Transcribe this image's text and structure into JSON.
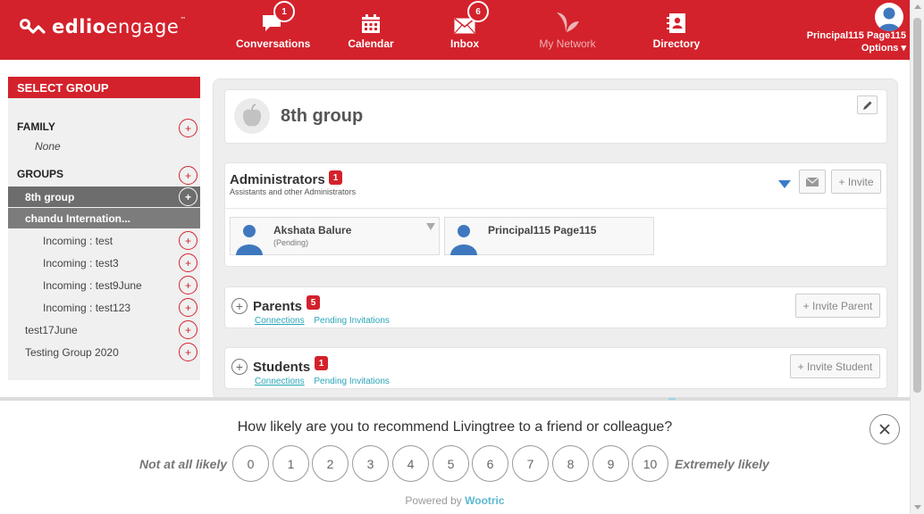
{
  "app": {
    "logo_bold": "edlio",
    "logo_light": "engage",
    "logo_tm": "™"
  },
  "nav": [
    {
      "label": "Conversations",
      "icon": "chat-bubble-icon",
      "badge": "1"
    },
    {
      "label": "Calendar",
      "icon": "calendar-icon",
      "badge": ""
    },
    {
      "label": "Inbox",
      "icon": "envelope-icon",
      "badge": "6"
    },
    {
      "label": "My Network",
      "icon": "leaf-icon",
      "badge": ""
    },
    {
      "label": "Directory",
      "icon": "directory-icon",
      "badge": ""
    }
  ],
  "user": {
    "name": "Principal115 Page115",
    "options_label": "Options ▾"
  },
  "sidebar": {
    "header": "SELECT GROUP",
    "family_label": "FAMILY",
    "family_none": "None",
    "groups_label": "GROUPS",
    "plus": "+",
    "items": [
      {
        "label": "8th group"
      },
      {
        "label": "chandu Internation..."
      },
      {
        "label": "Incoming : test"
      },
      {
        "label": "Incoming : test3"
      },
      {
        "label": "Incoming : test9June"
      },
      {
        "label": "Incoming : test123"
      },
      {
        "label": "test17June"
      },
      {
        "label": "Testing Group 2020"
      }
    ]
  },
  "group": {
    "title": "8th group"
  },
  "administrators": {
    "title": "Administrators",
    "badge": "1",
    "subtitle": "Assistants and other Administrators",
    "invite_label": "+ Invite",
    "members": [
      {
        "name": "Akshata Balure",
        "status": "(Pending)"
      },
      {
        "name": "Principal115 Page115",
        "status": ""
      }
    ]
  },
  "parents": {
    "title": "Parents",
    "badge": "5",
    "link_connections": "Connections",
    "link_pending": "Pending Invitations",
    "invite_label": "+ Invite Parent"
  },
  "students": {
    "title": "Students",
    "badge": "1",
    "link_connections": "Connections",
    "link_pending": "Pending Invitations",
    "invite_label": "+ Invite Student"
  },
  "survey": {
    "question": "How likely are you to recommend Livingtree to a friend or colleague?",
    "low_label": "Not at all likely",
    "high_label": "Extremely likely",
    "scores": [
      "0",
      "1",
      "2",
      "3",
      "4",
      "5",
      "6",
      "7",
      "8",
      "9",
      "10"
    ],
    "powered_prefix": "Powered by ",
    "powered_brand": "Wootric"
  },
  "colors": {
    "brand_red": "#d3222c",
    "link_teal": "#2aa6b8",
    "dropdown_blue": "#3a7bc8",
    "wootric_blue": "#5cb8d2"
  }
}
